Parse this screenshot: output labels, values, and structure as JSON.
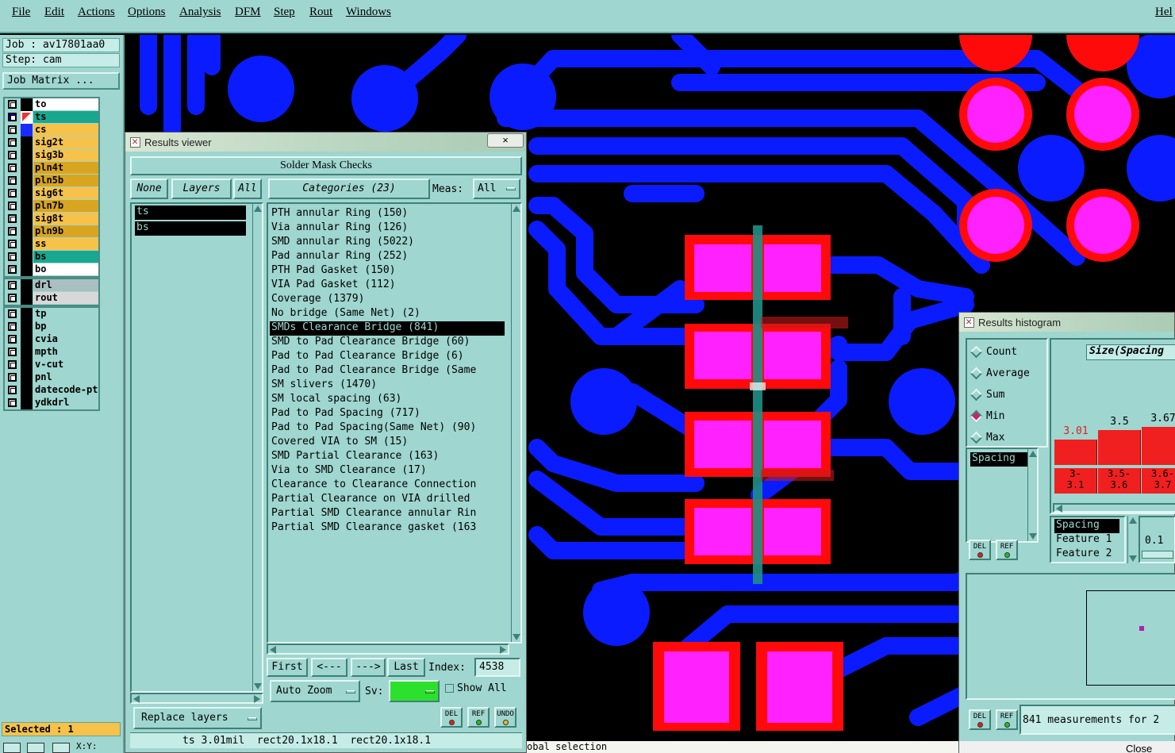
{
  "menu": [
    "File",
    "Edit",
    "Actions",
    "Options",
    "Analysis",
    "DFM",
    "Step",
    "Rout",
    "Windows"
  ],
  "menu_help": "Hel",
  "job": {
    "job_line": "Job : av17801aa0",
    "step_line": "Step: cam",
    "matrix_button": "Job Matrix ..."
  },
  "layers_group1": [
    {
      "name": "to",
      "color": "#ffffff"
    },
    {
      "name": "ts",
      "color": "#1aa78f"
    },
    {
      "name": "cs",
      "color": "#f6c24a"
    },
    {
      "name": "sig2t",
      "color": "#f6c24a"
    },
    {
      "name": "sig3b",
      "color": "#f6c24a"
    },
    {
      "name": "pln4t",
      "color": "#d9a520"
    },
    {
      "name": "pln5b",
      "color": "#d9a520"
    },
    {
      "name": "sig6t",
      "color": "#f6c24a"
    },
    {
      "name": "pln7b",
      "color": "#d9a520"
    },
    {
      "name": "sig8t",
      "color": "#f6c24a"
    },
    {
      "name": "pln9b",
      "color": "#d9a520"
    },
    {
      "name": "ss",
      "color": "#f6c24a"
    },
    {
      "name": "bs",
      "color": "#1aa78f"
    },
    {
      "name": "bo",
      "color": "#ffffff"
    }
  ],
  "layers_group2": [
    {
      "name": "drl",
      "color": "#a9bfc2"
    },
    {
      "name": "rout",
      "color": "#d8d8d8"
    }
  ],
  "layers_group3": [
    {
      "name": "tp",
      "color": "#9fd6cf"
    },
    {
      "name": "bp",
      "color": "#9fd6cf"
    },
    {
      "name": "cvia",
      "color": "#9fd6cf"
    },
    {
      "name": "mpth",
      "color": "#9fd6cf"
    },
    {
      "name": "v-cut",
      "color": "#9fd6cf"
    },
    {
      "name": "pnl",
      "color": "#9fd6cf"
    },
    {
      "name": "datecode-pte",
      "color": "#9fd6cf"
    },
    {
      "name": "ydkdrl",
      "color": "#9fd6cf"
    }
  ],
  "selected_text": "Selected : 1",
  "results_viewer": {
    "title": "Results viewer",
    "close": "×",
    "header": "Solder Mask Checks",
    "btn_none": "None",
    "btn_layers": "Layers",
    "btn_all": "All",
    "btn_categories": "Categories (23)",
    "meas_label": "Meas:",
    "meas_value": "All",
    "layers": [
      "ts",
      "bs"
    ],
    "categories": [
      "PTH annular Ring (150)",
      "Via annular Ring (126)",
      "SMD annular Ring (5022)",
      "Pad annular Ring (252)",
      "PTH Pad Gasket (150)",
      "VIA Pad Gasket (112)",
      "Coverage (1379)",
      "No bridge (Same Net) (2)",
      "SMDs Clearance Bridge (841)",
      "SMD to Pad Clearance Bridge (60)",
      "Pad to Pad Clearance Bridge (6)",
      "Pad to Pad Clearance Bridge (Same",
      "SM slivers (1470)",
      "SM local spacing (63)",
      "Pad to Pad Spacing (717)",
      "Pad to Pad Spacing(Same Net) (90)",
      "Covered VIA to SM (15)",
      "SMD Partial Clearance (163)",
      "Via to SMD Clearance (17)",
      "Clearance to Clearance Connection",
      "Partial Clearance on VIA drilled",
      "Partial SMD Clearance annular Rin",
      "Partial SMD Clearance gasket (163"
    ],
    "selected_category": "SMDs Clearance Bridge (841)",
    "btn_first": "First",
    "btn_prev": "<---",
    "btn_next": "--->",
    "btn_last": "Last",
    "index_label": "Index:",
    "index_value": "4538",
    "btn_autozoom": "Auto Zoom",
    "sv_label": "Sv:",
    "show_all": "Show All",
    "btn_replace": "Replace layers",
    "del": "DEL",
    "ref": "REF",
    "undo": "UNDO",
    "status": "ts 3.01mil  rect20.1x18.1  rect20.1x18.1"
  },
  "histogram": {
    "title": "Results histogram",
    "options": [
      "Count",
      "Average",
      "Sum",
      "Min",
      "Max"
    ],
    "selected_option": "Min",
    "measure_list": [
      "Spacing"
    ],
    "chart_title": "Size(Spacing",
    "bar_values": [
      "3.01",
      "3.5",
      "3.67"
    ],
    "bar_ranges": [
      "3-\n3.1",
      "3.5-\n3.6",
      "3.6-\n3.7"
    ],
    "fields": [
      "Spacing",
      "Feature 1",
      "Feature 2"
    ],
    "field_value": "0.1",
    "del": "DEL",
    "ref": "REF",
    "summary": "841 measurements for 2",
    "close": "Close"
  },
  "bottom_strip": {
    "left_text": "X:Y:",
    "status_text": "obal selection"
  },
  "colors": {
    "panel": "#9fd6cf",
    "blue_trace": "#0a1cff",
    "red_pad": "#ff0a0a",
    "magenta_pad": "#ff22ff"
  }
}
